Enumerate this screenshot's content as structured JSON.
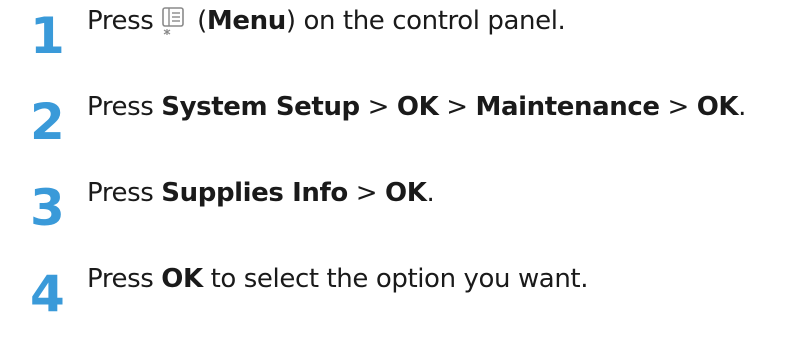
{
  "accent_color": "#3a9ad9",
  "steps": [
    {
      "number": "1",
      "before": "Press ",
      "icon": "menu-icon",
      "after_icon_open": " (",
      "bold_1": "Menu",
      "after_bold_1": ") on the control panel."
    },
    {
      "number": "2",
      "before": "Press ",
      "bold_1": "System Setup",
      "sep_1": " > ",
      "bold_2": "OK",
      "sep_2": " > ",
      "bold_3": "Maintenance",
      "sep_3": " > ",
      "bold_4": "OK",
      "end": "."
    },
    {
      "number": "3",
      "before": "Press ",
      "bold_1": "Supplies Info",
      "sep_1": " > ",
      "bold_2": "OK",
      "end": "."
    },
    {
      "number": "4",
      "before": "Press ",
      "bold_1": "OK",
      "after_bold_1": " to select the option you want."
    }
  ]
}
